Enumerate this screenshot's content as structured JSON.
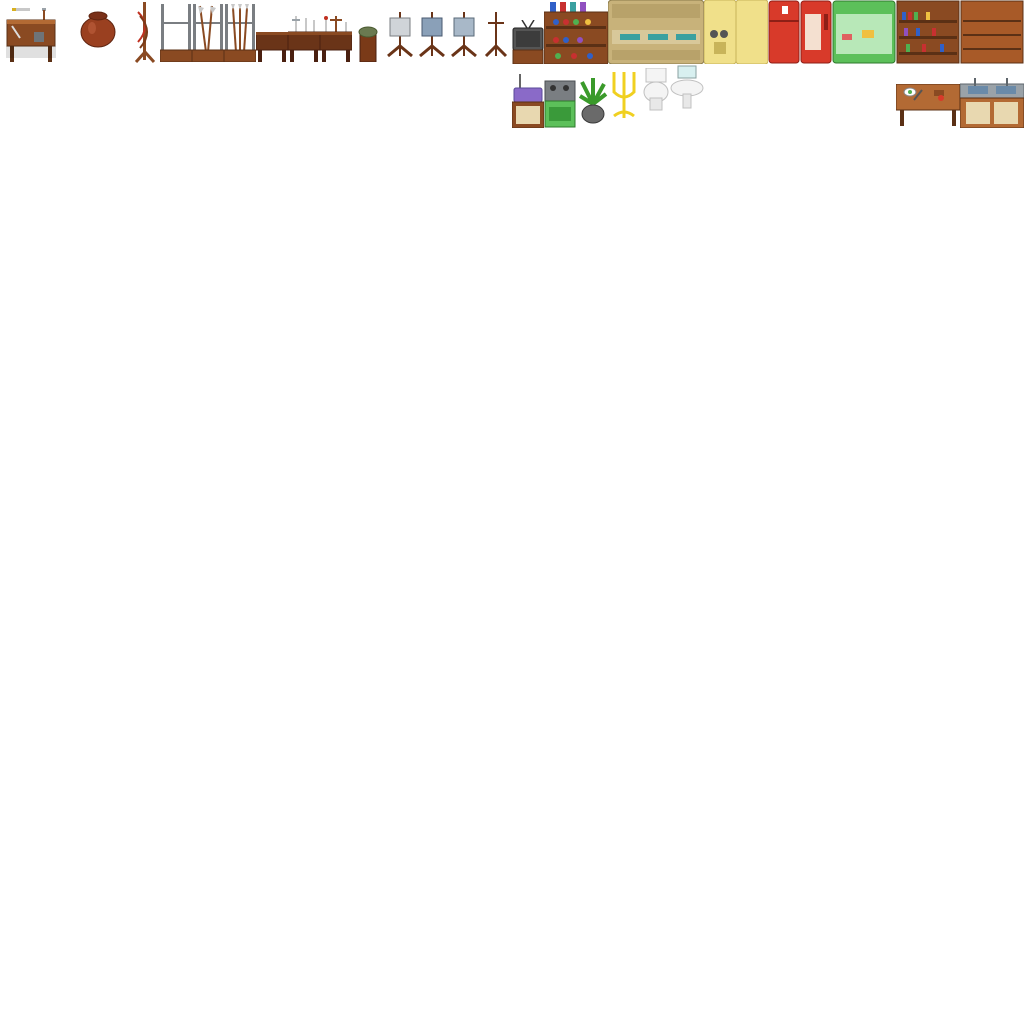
{
  "sheet": {
    "background": "#ffffff",
    "palette": {
      "wood_dark": "#5b3015",
      "wood": "#8a4a22",
      "wood_light": "#b36a34",
      "metal": "#9aa2a8",
      "metal_dark": "#5e666c",
      "cream": "#f0e08a",
      "cream_dark": "#c8b45a",
      "beige": "#c8b27a",
      "red": "#d83a2a",
      "red_dark": "#8e1f16",
      "green": "#5cc05a",
      "green_dark": "#2e7a2c",
      "teal": "#3aa0a0",
      "gold": "#f0d020",
      "porcelain": "#f4f4f4",
      "porcelain_shadow": "#c0c0c0",
      "purple": "#8a6ac8",
      "tv_screen": "#3c3c3c"
    }
  }
}
